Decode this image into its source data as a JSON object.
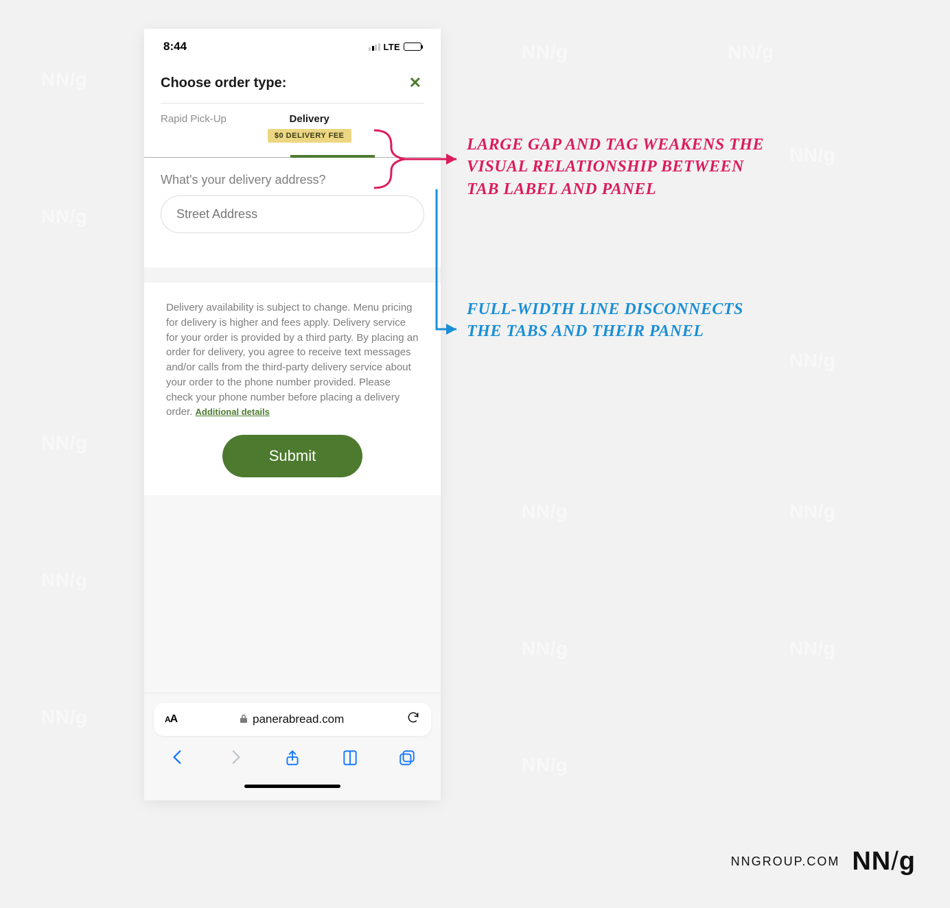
{
  "watermark": "NN/g",
  "status": {
    "time": "8:44",
    "network": "LTE"
  },
  "header": {
    "title": "Choose order type:"
  },
  "tabs": {
    "pickup": "Rapid Pick-Up",
    "delivery": "Delivery",
    "badge": "$0 DELIVERY FEE"
  },
  "address": {
    "question": "What's your delivery address?",
    "placeholder": "Street Address"
  },
  "fineprint": {
    "text": "Delivery availability is subject to change. Menu pricing for delivery is higher and fees apply. Delivery service for your order is provided by a third party. By placing an order for delivery, you agree to receive text messages and/or calls from the third-party delivery service about your order to the phone number provided. Please check your phone number before placing a delivery order. ",
    "link": "Additional details"
  },
  "submit": "Submit",
  "safari": {
    "domain": "panerabread.com"
  },
  "annotations": {
    "red": "Large gap and tag weakens the visual relationship between tab label and panel",
    "blue": "Full-width line disconnects the tabs and their panel"
  },
  "brand": {
    "url": "NNGROUP.COM",
    "logo_nn": "NN",
    "logo_g": "g"
  }
}
